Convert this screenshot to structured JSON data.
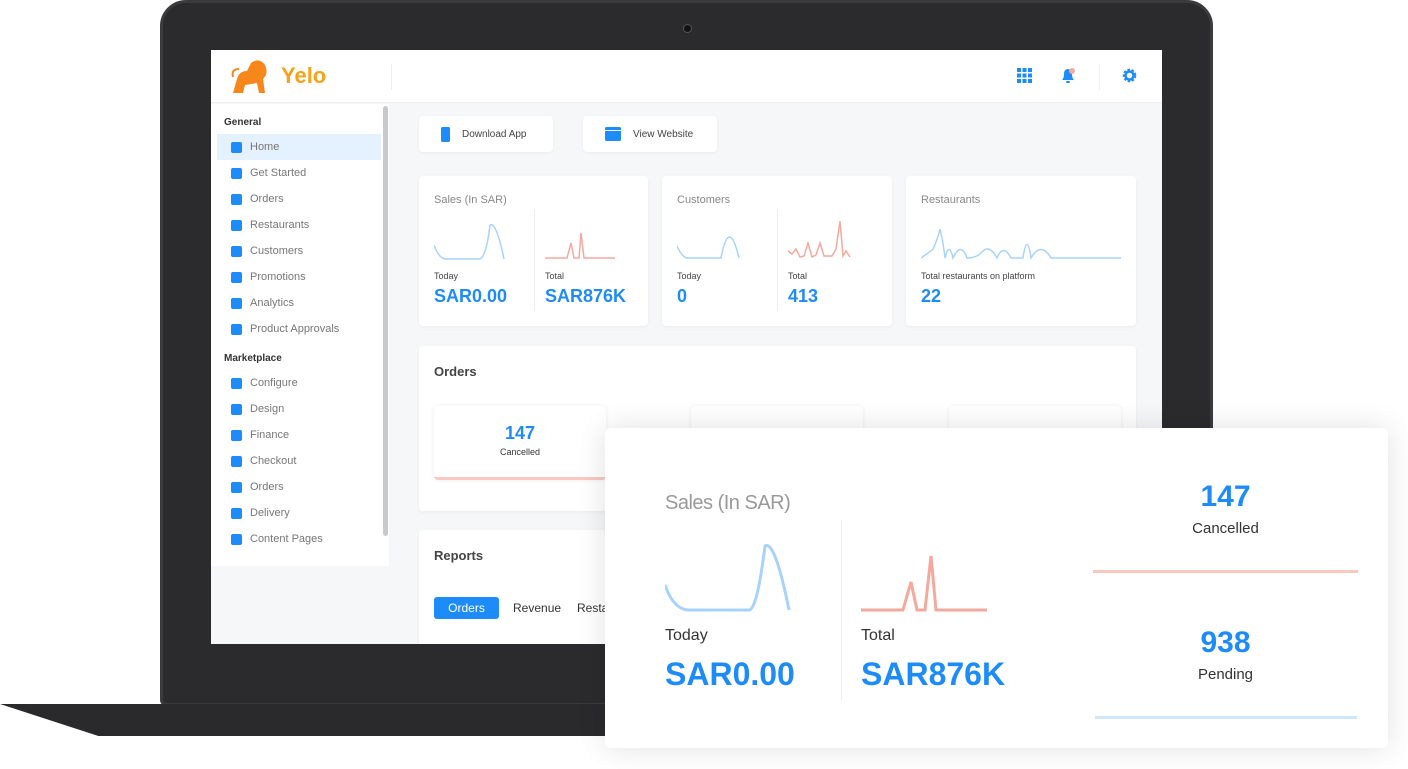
{
  "brand": {
    "name": "Yelo",
    "accent": "#1e8cf8",
    "sales_color": "#f4a99e",
    "logo_color": "#f7a21b"
  },
  "topbar": {
    "icons": [
      "grid-icon",
      "bell-icon",
      "gear-icon"
    ]
  },
  "sidebar": {
    "general_label": "General",
    "general": [
      {
        "label": "Home",
        "icon": "home-icon"
      },
      {
        "label": "Get Started",
        "icon": "lighthouse-icon"
      },
      {
        "label": "Orders",
        "icon": "list-icon"
      },
      {
        "label": "Restaurants",
        "icon": "store-icon"
      },
      {
        "label": "Customers",
        "icon": "user-icon"
      },
      {
        "label": "Promotions",
        "icon": "megaphone-icon"
      },
      {
        "label": "Analytics",
        "icon": "chart-icon"
      },
      {
        "label": "Product Approvals",
        "icon": "document-check-icon"
      }
    ],
    "marketplace_label": "Marketplace",
    "marketplace": [
      {
        "label": "Configure",
        "icon": "cog-icon"
      },
      {
        "label": "Design",
        "icon": "wand-icon"
      },
      {
        "label": "Finance",
        "icon": "money-bag-icon"
      },
      {
        "label": "Checkout",
        "icon": "cart-icon"
      },
      {
        "label": "Orders",
        "icon": "flow-icon"
      },
      {
        "label": "Delivery",
        "icon": "box-icon"
      },
      {
        "label": "Content Pages",
        "icon": "code-page-icon"
      }
    ]
  },
  "actions": {
    "download": "Download App",
    "website": "View Website"
  },
  "stats": {
    "sales": {
      "title": "Sales (In SAR)",
      "today_label": "Today",
      "today": "SAR0.00",
      "total_label": "Total",
      "total": "SAR876K"
    },
    "customers": {
      "title": "Customers",
      "today_label": "Today",
      "today": "0",
      "total_label": "Total",
      "total": "413"
    },
    "restaurants": {
      "title": "Restaurants",
      "label": "Total restaurants on platform",
      "value": "22"
    }
  },
  "orders": {
    "title": "Orders",
    "cancelled": "147",
    "cancelled_label": "Cancelled"
  },
  "reports": {
    "title": "Reports",
    "tabs": [
      "Orders",
      "Revenue",
      "Resta"
    ]
  },
  "popup": {
    "title": "Sales (In SAR)",
    "today_label": "Today",
    "today": "SAR0.00",
    "total_label": "Total",
    "total": "SAR876K",
    "cancelled": "147",
    "cancelled_label": "Cancelled",
    "pending": "938",
    "pending_label": "Pending"
  }
}
